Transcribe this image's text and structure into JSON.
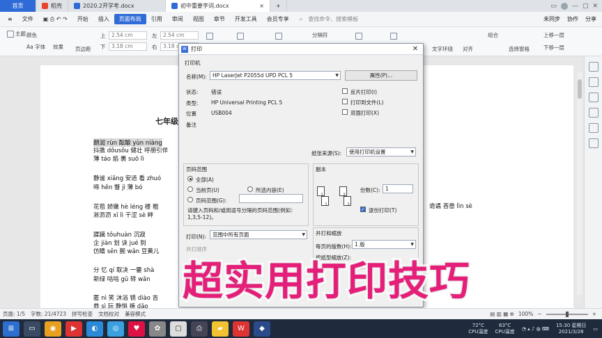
{
  "tabs": [
    {
      "label": "首页",
      "icon": "home-icon"
    },
    {
      "label": "稻壳",
      "icon": "docer-icon"
    },
    {
      "label": "2020.2开学考.docx",
      "icon": "word-doc-icon"
    },
    {
      "label": "初中重要字词.docx",
      "icon": "word-doc-icon"
    }
  ],
  "menu": {
    "file": "文件",
    "items": [
      "开始",
      "插入",
      "页面布局",
      "引用",
      "审阅",
      "视图",
      "章节",
      "开发工具",
      "会员专享"
    ],
    "active": "页面布局",
    "search": "查找命令、搜索模板",
    "sync": "未同步",
    "collab": "协作",
    "share": "分享"
  },
  "toolbar": {
    "theme": "主题",
    "color": "颜色",
    "font": "Aa 字体",
    "effect": "效果",
    "margin": "页边距",
    "m_top": "2.54 cm",
    "m_bottom": "3.18 cm",
    "m_left": "2.54 cm",
    "m_right": "3.18 cm",
    "t_label": "上",
    "b_label": "下",
    "l_label": "左",
    "r_label": "右",
    "separator": "分隔符",
    "text_wrap": "文字环绕",
    "align": "对齐",
    "rotate": "旋转",
    "select_pane": "选择窗格",
    "group": "组合",
    "up": "上移一层",
    "down": "下移一层"
  },
  "document": {
    "title": "七年级",
    "lines": [
      "朗润 rùn   酝酿 yùn niàng",
      "抖擞 dǒusǒu  健壮  呼朋引伴",
      "薄 táo 焰    裹 suō lì",
      "静谧 xiǎng  安适   看 zhuó",
      "啼 hěn     瞥 jì   薄 bó",
      "花苞  娇嫩 hè léng 楼  粗",
      "淅沥沥 xī lì   干涩 sè  畔",
      "蹂躏 tǒuhuàn     沉寂",
      "企 jiàn 划   诀 jué 别",
      "仿睛 sēn   腕 wǎn 豆黄儿",
      "分 忆 qí   取决   一霎 shà",
      "新绿    咕咕 gū   转 wǎn",
      "匿 nì 笑  沐浴  锈 diào 吉",
      "恭 sì 玩  静悄  祷 dǎo"
    ],
    "right_text": "诡谲   吝啬 lìn sè"
  },
  "dialog": {
    "title": "打印",
    "printer_section": "打印机",
    "name_label": "名称(M):",
    "printer_name": "HP LaserJet P2055d UPD PCL 5",
    "properties_btn": "属性(P)...",
    "status_label": "状态:",
    "status_value": "错误",
    "type_label": "类型:",
    "type_value": "HP Universal Printing PCL 5",
    "where_label": "位置",
    "where_value": "USB004",
    "comment_label": "备注",
    "reverse_print": "反片打印(I)",
    "print_to_file": "打印到文件(L)",
    "duplex": "双面打印(X)",
    "paper_source_label": "纸张来源(S):",
    "paper_source_value": "使用打印机设置",
    "range_section": "页码范围",
    "range_all": "全部(A)",
    "range_current": "当前页(U)",
    "range_selection": "所选内容(E)",
    "range_pages": "页码范围(G):",
    "range_hint": "请键入页码和/或用逗号分隔的页码范围(例如：1,3,5-12)。",
    "copies_section": "副本",
    "copies_label": "份数(C):",
    "copies_value": "1",
    "collate": "逐份打印(T)",
    "print_label": "打印(N):",
    "print_value": "范围中所有页面",
    "merge_label": "并打顺序",
    "zoom_section": "并打和缩放",
    "pages_per_sheet_label": "每页的版数(H):",
    "pages_per_sheet_value": "1 版",
    "scale_label": "按纸型缩放(Z):"
  },
  "overlay_text": "超实用打印技巧",
  "status": {
    "page": "页面: 1/5",
    "words": "字数: 21/4723",
    "spell": "拼写检查",
    "proof": "文档校对",
    "compat": "兼容模式",
    "zoom": "100%"
  },
  "taskbar": {
    "cpu_temp_value": "72°C",
    "cpu_temp_label": "CPU温度",
    "cpu_usage_value": "63°C",
    "cpu_usage_label": "CPU温度",
    "time": "15:30 星期日",
    "date": "2021/3/28"
  },
  "colors": {
    "accent": "#2f6bd6",
    "overlay": "#e51e7a",
    "taskbar": "#1f2a3c"
  }
}
